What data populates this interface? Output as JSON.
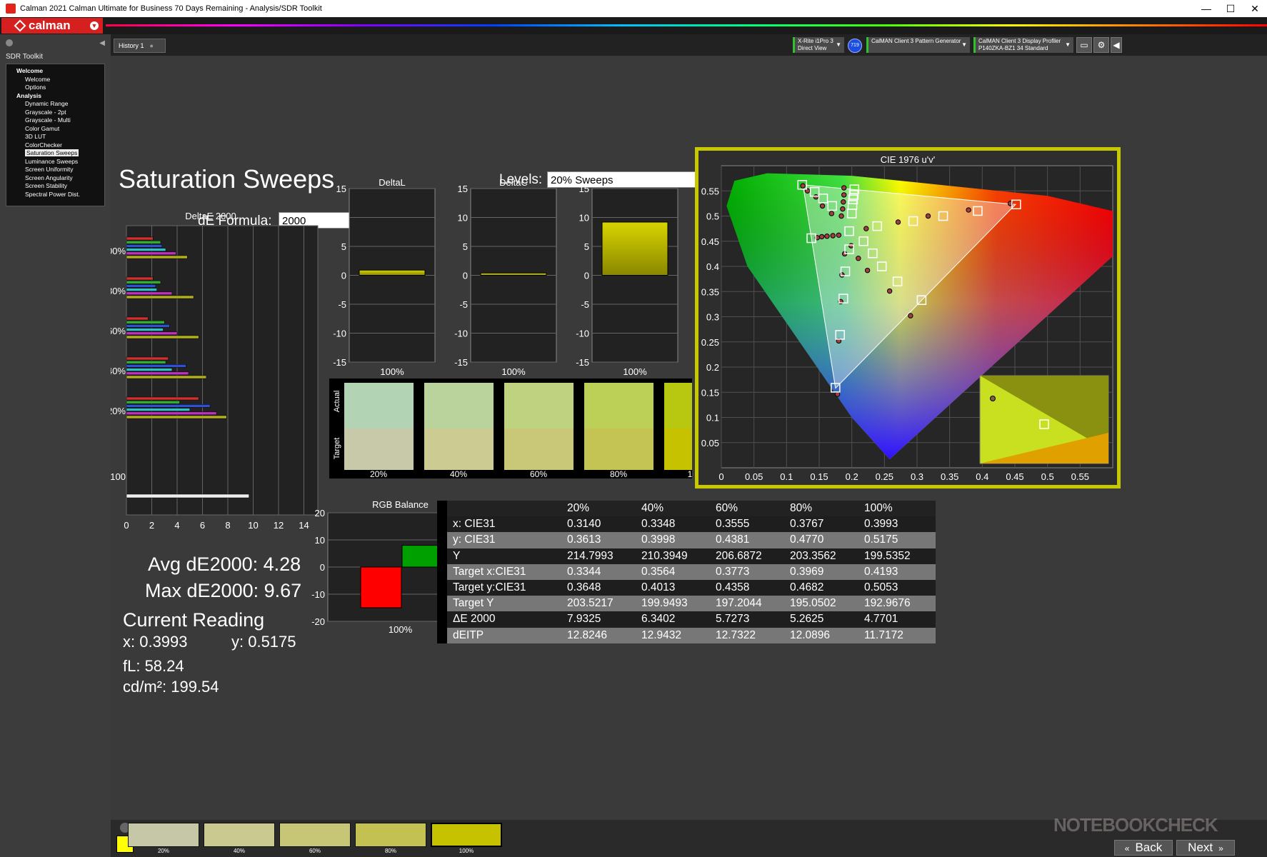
{
  "window": {
    "title": "Calman 2021 Calman Ultimate for Business 70 Days Remaining  - Analysis/SDR Toolkit",
    "controls": [
      "—",
      "☐",
      "✕"
    ]
  },
  "app": {
    "logo": "calman"
  },
  "sidebar": {
    "title": "SDR Toolkit",
    "tree": [
      {
        "label": "Welcome",
        "type": "sec"
      },
      {
        "label": "Welcome",
        "type": "itm"
      },
      {
        "label": "Options",
        "type": "itm"
      },
      {
        "label": "Analysis",
        "type": "sec"
      },
      {
        "label": "Dynamic Range",
        "type": "itm"
      },
      {
        "label": "Grayscale - 2pt",
        "type": "itm"
      },
      {
        "label": "Grayscale - Multi",
        "type": "itm"
      },
      {
        "label": "Color Gamut",
        "type": "itm"
      },
      {
        "label": "3D LUT",
        "type": "itm"
      },
      {
        "label": "ColorChecker",
        "type": "itm"
      },
      {
        "label": "Saturation Sweeps",
        "type": "itm",
        "selected": true
      },
      {
        "label": "Luminance Sweeps",
        "type": "itm"
      },
      {
        "label": "Screen Uniformity",
        "type": "itm"
      },
      {
        "label": "Screen Angularity",
        "type": "itm"
      },
      {
        "label": "Screen Stability",
        "type": "itm"
      },
      {
        "label": "Spectral Power Dist.",
        "type": "itm"
      }
    ]
  },
  "toolbar": {
    "history_tab": "History 1",
    "meter": {
      "line1": "X-Rite i1Pro 3",
      "line2": "Direct View"
    },
    "badge": "719",
    "pattern": {
      "line1": "CalMAN Client 3 Pattern Generator"
    },
    "display": {
      "line1": "CalMAN Client 3 Display Profiler",
      "line2": "P140ZKA-BZ1 34 Standard"
    }
  },
  "page": {
    "title": "Saturation Sweeps",
    "levels_label": "Levels:",
    "levels_value": "20% Sweeps",
    "formula_label": "dE Formula:",
    "formula_value": "2000"
  },
  "summary": {
    "avg": "Avg dE2000: 4.28",
    "max": "Max dE2000: 9.67"
  },
  "current": {
    "title": "Current Reading",
    "x": "x: 0.3993",
    "y": "y: 0.5175",
    "fl": "fL: 58.24",
    "cd": "cd/m²: 199.54"
  },
  "chart_data": [
    {
      "type": "bar",
      "orientation": "horizontal",
      "title": "DeltaE 2000",
      "xlim": [
        0,
        15
      ],
      "x_ticks": [
        "0",
        "2",
        "4",
        "6",
        "8",
        "10",
        "12",
        "14"
      ],
      "categories": [
        "100%",
        "80%",
        "60%",
        "40%",
        "20%",
        "100"
      ],
      "series": [
        {
          "color": "#d03030",
          "values": [
            2.1,
            2.1,
            1.7,
            3.3,
            5.7
          ]
        },
        {
          "color": "#30b030",
          "values": [
            2.7,
            2.7,
            3.0,
            3.1,
            4.2
          ]
        },
        {
          "color": "#3050d0",
          "values": [
            2.8,
            2.3,
            3.4,
            4.7,
            6.6
          ]
        },
        {
          "color": "#30c0c0",
          "values": [
            3.1,
            2.4,
            2.9,
            3.6,
            5.0
          ]
        },
        {
          "color": "#c030c0",
          "values": [
            3.9,
            3.6,
            4.0,
            4.9,
            7.1
          ]
        },
        {
          "color": "#b0b020",
          "values": [
            4.8,
            5.3,
            5.7,
            6.3,
            7.9
          ]
        }
      ],
      "gray_value": 9.67
    },
    {
      "type": "bar",
      "title": "DeltaL",
      "categories": [
        "100%"
      ],
      "values": [
        0.9
      ],
      "ylim": [
        -15,
        15
      ],
      "y_ticks": [
        "15",
        "10",
        "5",
        "0",
        "-5",
        "-10",
        "-15"
      ]
    },
    {
      "type": "bar",
      "title": "DeltaC",
      "categories": [
        "100%"
      ],
      "values": [
        0.4
      ],
      "ylim": [
        -15,
        15
      ],
      "y_ticks": [
        "15",
        "10",
        "5",
        "0",
        "-5",
        "-10",
        "-15"
      ]
    },
    {
      "type": "bar",
      "title": "DeltaH",
      "categories": [
        "100%"
      ],
      "values": [
        9.2
      ],
      "ylim": [
        -15,
        15
      ],
      "y_ticks": [
        "15",
        "10",
        "5",
        "0",
        "-5",
        "-10",
        "-15"
      ]
    },
    {
      "type": "bar",
      "title": "RGB Balance",
      "categories": [
        "100%"
      ],
      "series": [
        {
          "color": "#ff0000",
          "values": [
            -15
          ]
        },
        {
          "color": "#00a000",
          "values": [
            8
          ]
        },
        {
          "color": "#1010ff",
          "values": [
            12
          ]
        }
      ],
      "ylim": [
        -20,
        20
      ],
      "y_ticks": [
        "20",
        "10",
        "0",
        "-10",
        "-20"
      ]
    },
    {
      "type": "scatter",
      "title": "CIE 1976 u'v'",
      "xlim": [
        0,
        0.6
      ],
      "ylim": [
        0,
        0.6
      ],
      "x_ticks": [
        "0",
        "0.05",
        "0.1",
        "0.15",
        "0.2",
        "0.25",
        "0.3",
        "0.35",
        "0.4",
        "0.45",
        "0.5",
        "0.55"
      ],
      "y_ticks": [
        "0.55",
        "0.5",
        "0.45",
        "0.4",
        "0.35",
        "0.3",
        "0.25",
        "0.2",
        "0.15",
        "0.1",
        "0.05"
      ],
      "targets": [
        [
          0.124,
          0.562
        ],
        [
          0.143,
          0.548
        ],
        [
          0.156,
          0.535
        ],
        [
          0.17,
          0.52
        ],
        [
          0.204,
          0.553
        ],
        [
          0.203,
          0.542
        ],
        [
          0.202,
          0.533
        ],
        [
          0.201,
          0.522
        ],
        [
          0.2,
          0.505
        ],
        [
          0.196,
          0.47
        ],
        [
          0.239,
          0.48
        ],
        [
          0.294,
          0.49
        ],
        [
          0.34,
          0.5
        ],
        [
          0.393,
          0.51
        ],
        [
          0.452,
          0.523
        ],
        [
          0.218,
          0.45
        ],
        [
          0.232,
          0.426
        ],
        [
          0.246,
          0.4
        ],
        [
          0.27,
          0.37
        ],
        [
          0.307,
          0.333
        ],
        [
          0.196,
          0.434
        ],
        [
          0.19,
          0.39
        ],
        [
          0.187,
          0.336
        ],
        [
          0.182,
          0.264
        ],
        [
          0.175,
          0.159
        ],
        [
          0.138,
          0.456
        ]
      ],
      "measured": [
        [
          0.125,
          0.56
        ],
        [
          0.132,
          0.55
        ],
        [
          0.145,
          0.538
        ],
        [
          0.155,
          0.52
        ],
        [
          0.169,
          0.505
        ],
        [
          0.188,
          0.556
        ],
        [
          0.188,
          0.542
        ],
        [
          0.187,
          0.528
        ],
        [
          0.186,
          0.514
        ],
        [
          0.184,
          0.5
        ],
        [
          0.222,
          0.475
        ],
        [
          0.271,
          0.488
        ],
        [
          0.317,
          0.5
        ],
        [
          0.379,
          0.512
        ],
        [
          0.443,
          0.525
        ],
        [
          0.199,
          0.441
        ],
        [
          0.21,
          0.416
        ],
        [
          0.224,
          0.392
        ],
        [
          0.258,
          0.351
        ],
        [
          0.29,
          0.302
        ],
        [
          0.189,
          0.425
        ],
        [
          0.185,
          0.383
        ],
        [
          0.183,
          0.33
        ],
        [
          0.18,
          0.252
        ],
        [
          0.178,
          0.146
        ],
        [
          0.147,
          0.457
        ],
        [
          0.154,
          0.459
        ],
        [
          0.162,
          0.46
        ],
        [
          0.171,
          0.461
        ],
        [
          0.18,
          0.462
        ]
      ]
    }
  ],
  "swatches": {
    "actual_label": "Actual",
    "target_label": "Target",
    "items": [
      {
        "label": "20%",
        "actual": "#b3d3b5",
        "target": "#c8c9a8"
      },
      {
        "label": "40%",
        "actual": "#bad39c",
        "target": "#cbcb92"
      },
      {
        "label": "60%",
        "actual": "#bed27f",
        "target": "#c9c878"
      },
      {
        "label": "80%",
        "actual": "#bcd057",
        "target": "#c4c454"
      },
      {
        "label": "100%",
        "actual": "#b8c810",
        "target": "#c6c200"
      }
    ]
  },
  "table": {
    "headers": [
      "",
      "20%",
      "40%",
      "60%",
      "80%",
      "100%"
    ],
    "rows": [
      [
        "x: CIE31",
        "0.3140",
        "0.3348",
        "0.3555",
        "0.3767",
        "0.3993"
      ],
      [
        "y: CIE31",
        "0.3613",
        "0.3998",
        "0.4381",
        "0.4770",
        "0.5175"
      ],
      [
        "Y",
        "214.7993",
        "210.3949",
        "206.6872",
        "203.3562",
        "199.5352"
      ],
      [
        "Target x:CIE31",
        "0.3344",
        "0.3564",
        "0.3773",
        "0.3969",
        "0.4193"
      ],
      [
        "Target y:CIE31",
        "0.3648",
        "0.4013",
        "0.4358",
        "0.4682",
        "0.5053"
      ],
      [
        "Target Y",
        "203.5217",
        "199.9493",
        "197.2044",
        "195.0502",
        "192.9676"
      ],
      [
        "ΔE 2000",
        "7.9325",
        "6.3402",
        "5.7273",
        "5.2625",
        "4.7701"
      ],
      [
        "dEITP",
        "12.8246",
        "12.9432",
        "12.7322",
        "12.0896",
        "11.7172"
      ]
    ]
  },
  "bottom": {
    "swatches": [
      {
        "label": "20%",
        "color": "#c6c7a6"
      },
      {
        "label": "40%",
        "color": "#c9c990"
      },
      {
        "label": "60%",
        "color": "#c7c676"
      },
      {
        "label": "80%",
        "color": "#c2c152"
      },
      {
        "label": "100%",
        "color": "#c6c200"
      }
    ],
    "back": "Back",
    "next": "Next"
  },
  "watermark": "NOTEBOOKCHECK"
}
